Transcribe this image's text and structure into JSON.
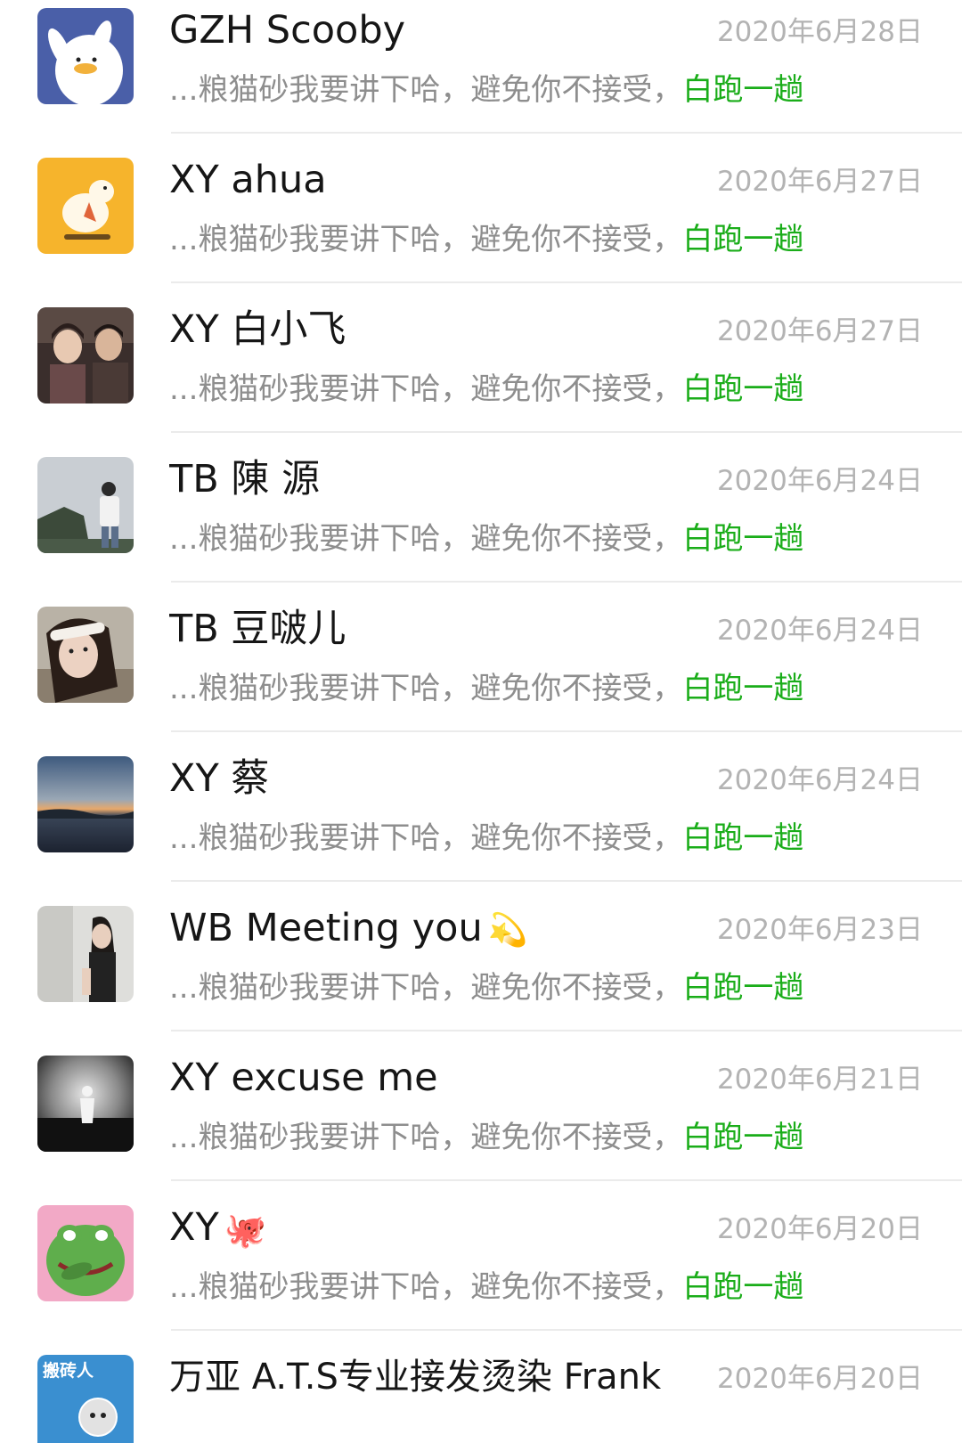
{
  "chats": [
    {
      "name": "GZH Scooby",
      "emoji": "",
      "date": "2020年6月28日",
      "preview_prefix": "...粮猫砂我要讲下哈，避免你不接受，",
      "preview_highlight": "白跑一趟",
      "avatar": "white-duck-on-blue"
    },
    {
      "name": "XY ahua",
      "emoji": "",
      "date": "2020年6月27日",
      "preview_prefix": "...粮猫砂我要讲下哈，避免你不接受，",
      "preview_highlight": "白跑一趟",
      "avatar": "duck-on-yellow"
    },
    {
      "name": "XY 白小飞",
      "emoji": "",
      "date": "2020年6月27日",
      "preview_prefix": "...粮猫砂我要讲下哈，避免你不接受，",
      "preview_highlight": "白跑一趟",
      "avatar": "anime-boys"
    },
    {
      "name": "TB 陳 源",
      "emoji": "",
      "date": "2020年6月24日",
      "preview_prefix": "...粮猫砂我要讲下哈，避免你不接受，",
      "preview_highlight": "白跑一趟",
      "avatar": "man-on-cliff"
    },
    {
      "name": "TB 豆啵儿",
      "emoji": "",
      "date": "2020年6月24日",
      "preview_prefix": "...粮猫砂我要讲下哈，避免你不接受，",
      "preview_highlight": "白跑一趟",
      "avatar": "girl-selfie"
    },
    {
      "name": "XY 蔡",
      "emoji": "",
      "date": "2020年6月24日",
      "preview_prefix": "...粮猫砂我要讲下哈，避免你不接受，",
      "preview_highlight": "白跑一趟",
      "avatar": "sunset-lake"
    },
    {
      "name": "WB Meeting you",
      "emoji": "💫",
      "date": "2020年6月23日",
      "preview_prefix": "...粮猫砂我要讲下哈，避免你不接受，",
      "preview_highlight": "白跑一趟",
      "avatar": "woman-portrait"
    },
    {
      "name": "XY excuse me",
      "emoji": "",
      "date": "2020年6月21日",
      "preview_prefix": "...粮猫砂我要讲下哈，避免你不接受，",
      "preview_highlight": "白跑一趟",
      "avatar": "bw-figure"
    },
    {
      "name": "XY",
      "emoji": "🐙",
      "date": "2020年6月20日",
      "preview_prefix": "...粮猫砂我要讲下哈，避免你不接受，",
      "preview_highlight": "白跑一趟",
      "avatar": "green-frog"
    },
    {
      "name": "万亚 A.T.S专业接发烫染  Frank",
      "emoji": "",
      "date": "2020年6月20日",
      "preview_prefix": "",
      "preview_highlight": "",
      "avatar": "cartoon-worker",
      "avatar_text": "搬砖人"
    }
  ],
  "colors": {
    "name": "#161616",
    "date": "#b3b3b3",
    "preview": "#8e8e8e",
    "highlight": "#1aad19",
    "divider": "#ebebeb"
  }
}
